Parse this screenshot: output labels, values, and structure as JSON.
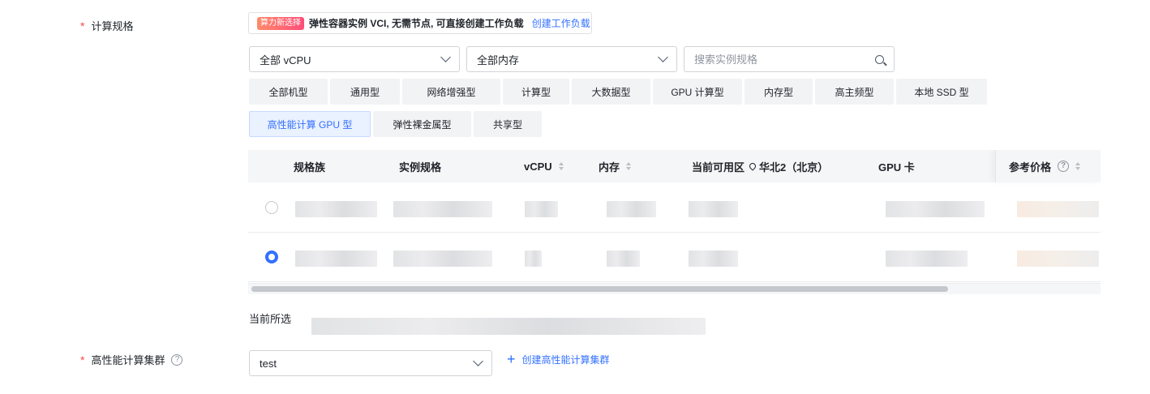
{
  "compute_spec": {
    "label": "计算规格",
    "required_mark": "*",
    "promo": {
      "badge": "算力新选择",
      "text": "弹性容器实例 VCI, 无需节点, 可直接创建工作负载",
      "link": "创建工作负载"
    },
    "filters": {
      "vcpu_select": "全部 vCPU",
      "memory_select": "全部内存",
      "search_placeholder": "搜索实例规格"
    },
    "types": [
      "全部机型",
      "通用型",
      "网络增强型",
      "计算型",
      "大数据型",
      "GPU 计算型",
      "内存型",
      "高主频型",
      "本地 SSD 型",
      "高性能计算 GPU 型",
      "弹性裸金属型",
      "共享型"
    ],
    "active_type": "高性能计算 GPU 型"
  },
  "table": {
    "headers": {
      "family": "规格族",
      "spec": "实例规格",
      "vcpu": "vCPU",
      "memory": "内存",
      "zone_prefix": "当前可用区",
      "zone": "华北2（北京）",
      "gpu": "GPU 卡",
      "price": "参考价格",
      "help": "?"
    },
    "rows": [
      {
        "selected": false
      },
      {
        "selected": true
      }
    ]
  },
  "current_selection": {
    "label": "当前所选"
  },
  "hpc_cluster": {
    "label": "高性能计算集群",
    "required_mark": "*",
    "help": "?",
    "value": "test",
    "create_link": "创建高性能计算集群",
    "plus": "+"
  },
  "colors": {
    "accent": "#3370ff",
    "required": "#f54a45",
    "header_bg": "#f5f6f7"
  }
}
